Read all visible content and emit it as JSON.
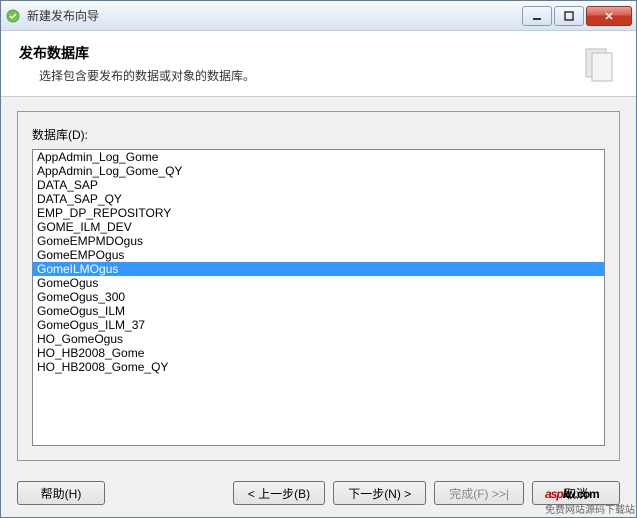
{
  "titlebar": {
    "title": "新建发布向导"
  },
  "header": {
    "title": "发布数据库",
    "subtitle": "选择包含要发布的数据或对象的数据库。"
  },
  "content": {
    "list_label": "数据库(D):",
    "items": [
      "AppAdmin_Log_Gome",
      "AppAdmin_Log_Gome_QY",
      "DATA_SAP",
      "DATA_SAP_QY",
      "EMP_DP_REPOSITORY",
      "GOME_ILM_DEV",
      "GomeEMPMDOgus",
      "GomeEMPOgus",
      "GomeILMOgus",
      "GomeOgus",
      "GomeOgus_300",
      "GomeOgus_ILM",
      "GomeOgus_ILM_37",
      "HO_GomeOgus",
      "HO_HB2008_Gome",
      "HO_HB2008_Gome_QY"
    ],
    "selected_index": 8
  },
  "buttons": {
    "help": "帮助(H)",
    "back": "< 上一步(B)",
    "next": "下一步(N) >",
    "finish": "完成(F) >>|",
    "cancel": "取消"
  },
  "watermark": {
    "brand_a": "asp",
    "brand_b": "ku",
    "dot": ".",
    "com": "com",
    "sub": "免费网站源码下载站"
  }
}
